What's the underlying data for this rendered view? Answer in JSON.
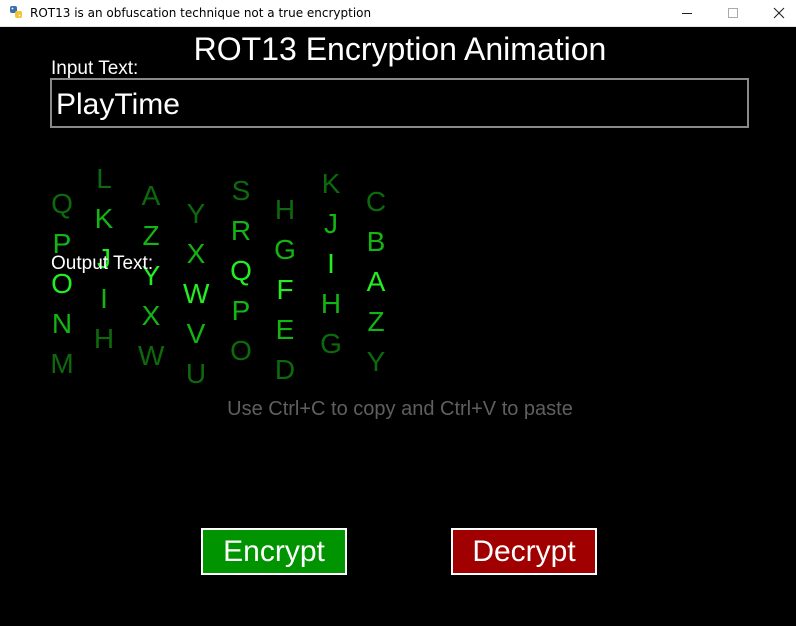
{
  "window": {
    "title": "ROT13 is an obfuscation technique not a true encryption"
  },
  "app": {
    "heading": "ROT13 Encryption Animation",
    "input_label": "Input Text:",
    "input_value": "PlayTime",
    "output_label": "Output Text:",
    "hint": "Use Ctrl+C to copy and Ctrl+V to paste",
    "encrypt_label": "Encrypt",
    "decrypt_label": "Decrypt"
  },
  "animation": {
    "columns": [
      [
        "Q",
        "P",
        "O",
        "N",
        "M"
      ],
      [
        "L",
        "K",
        "J",
        "I",
        "H"
      ],
      [
        "A",
        "Z",
        "Y",
        "X",
        "W"
      ],
      [
        "Y",
        "X",
        "W",
        "V",
        "U"
      ],
      [
        "S",
        "R",
        "Q",
        "P",
        "O"
      ],
      [
        "H",
        "G",
        "F",
        "E",
        "D"
      ],
      [
        "K",
        "J",
        "I",
        "H",
        "G"
      ],
      [
        "C",
        "B",
        "A",
        "Z",
        "Y"
      ]
    ]
  },
  "colors": {
    "encrypt": "#009500",
    "decrypt": "#a00000",
    "letter_bright": "#22ee22",
    "letter_mid": "#12b512",
    "letter_dim": "#0c6a0c"
  }
}
